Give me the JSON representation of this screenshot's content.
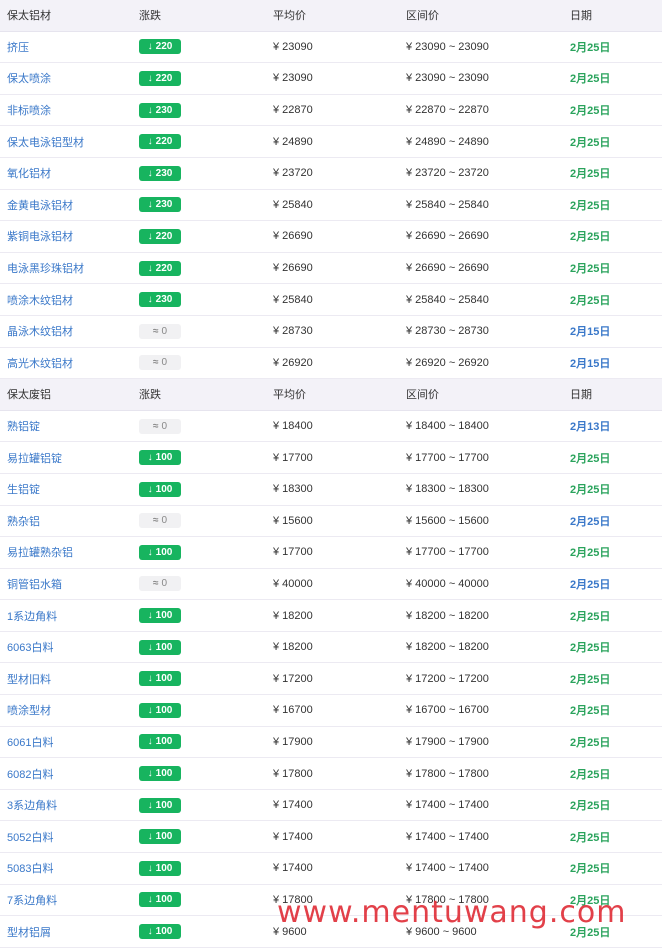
{
  "colors": {
    "down_badge": "#17b45f",
    "flat_badge": "#f1f1f3",
    "name_link": "#3a78c9",
    "date_green": "#2aa35c",
    "date_blue": "#3a78c9",
    "watermark": "#e0303a"
  },
  "icons": {
    "down": "down-arrow-icon",
    "flat": "approx-icon"
  },
  "sections": [
    {
      "header": {
        "category": "保太铝材",
        "change": "涨跌",
        "avg": "平均价",
        "range": "区间价",
        "date": "日期"
      },
      "rows": [
        {
          "name": "挤压",
          "trend": "down",
          "change": "220",
          "avg": "¥ 23090",
          "range": "¥ 23090 ~ 23090",
          "date": "2月25日",
          "date_color": "green"
        },
        {
          "name": "保太喷涂",
          "trend": "down",
          "change": "220",
          "avg": "¥ 23090",
          "range": "¥ 23090 ~ 23090",
          "date": "2月25日",
          "date_color": "green"
        },
        {
          "name": "非标喷涂",
          "trend": "down",
          "change": "230",
          "avg": "¥ 22870",
          "range": "¥ 22870 ~ 22870",
          "date": "2月25日",
          "date_color": "green"
        },
        {
          "name": "保太电泳铝型材",
          "trend": "down",
          "change": "220",
          "avg": "¥ 24890",
          "range": "¥ 24890 ~ 24890",
          "date": "2月25日",
          "date_color": "green"
        },
        {
          "name": "氧化铝材",
          "trend": "down",
          "change": "230",
          "avg": "¥ 23720",
          "range": "¥ 23720 ~ 23720",
          "date": "2月25日",
          "date_color": "green"
        },
        {
          "name": "金黄电泳铝材",
          "trend": "down",
          "change": "230",
          "avg": "¥ 25840",
          "range": "¥ 25840 ~ 25840",
          "date": "2月25日",
          "date_color": "green"
        },
        {
          "name": "紫铜电泳铝材",
          "trend": "down",
          "change": "220",
          "avg": "¥ 26690",
          "range": "¥ 26690 ~ 26690",
          "date": "2月25日",
          "date_color": "green"
        },
        {
          "name": "电泳黑珍珠铝材",
          "trend": "down",
          "change": "220",
          "avg": "¥ 26690",
          "range": "¥ 26690 ~ 26690",
          "date": "2月25日",
          "date_color": "green"
        },
        {
          "name": "喷涂木纹铝材",
          "trend": "down",
          "change": "230",
          "avg": "¥ 25840",
          "range": "¥ 25840 ~ 25840",
          "date": "2月25日",
          "date_color": "green"
        },
        {
          "name": "晶泳木纹铝材",
          "trend": "flat",
          "change": "0",
          "avg": "¥ 28730",
          "range": "¥ 28730 ~ 28730",
          "date": "2月15日",
          "date_color": "blue"
        },
        {
          "name": "高光木纹铝材",
          "trend": "flat",
          "change": "0",
          "avg": "¥ 26920",
          "range": "¥ 26920 ~ 26920",
          "date": "2月15日",
          "date_color": "blue"
        }
      ]
    },
    {
      "header": {
        "category": "保太废铝",
        "change": "涨跌",
        "avg": "平均价",
        "range": "区间价",
        "date": "日期"
      },
      "rows": [
        {
          "name": "熟铝锭",
          "trend": "flat",
          "change": "0",
          "avg": "¥ 18400",
          "range": "¥ 18400 ~ 18400",
          "date": "2月13日",
          "date_color": "blue"
        },
        {
          "name": "易拉罐铝锭",
          "trend": "down",
          "change": "100",
          "avg": "¥ 17700",
          "range": "¥ 17700 ~ 17700",
          "date": "2月25日",
          "date_color": "green"
        },
        {
          "name": "生铝锭",
          "trend": "down",
          "change": "100",
          "avg": "¥ 18300",
          "range": "¥ 18300 ~ 18300",
          "date": "2月25日",
          "date_color": "green"
        },
        {
          "name": "熟杂铝",
          "trend": "flat",
          "change": "0",
          "avg": "¥ 15600",
          "range": "¥ 15600 ~ 15600",
          "date": "2月25日",
          "date_color": "blue"
        },
        {
          "name": "易拉罐熟杂铝",
          "trend": "down",
          "change": "100",
          "avg": "¥ 17700",
          "range": "¥ 17700 ~ 17700",
          "date": "2月25日",
          "date_color": "green"
        },
        {
          "name": "铜管铝水箱",
          "trend": "flat",
          "change": "0",
          "avg": "¥ 40000",
          "range": "¥ 40000 ~ 40000",
          "date": "2月25日",
          "date_color": "blue"
        },
        {
          "name": "1系边角料",
          "trend": "down",
          "change": "100",
          "avg": "¥ 18200",
          "range": "¥ 18200 ~ 18200",
          "date": "2月25日",
          "date_color": "green"
        },
        {
          "name": "6063白料",
          "trend": "down",
          "change": "100",
          "avg": "¥ 18200",
          "range": "¥ 18200 ~ 18200",
          "date": "2月25日",
          "date_color": "green"
        },
        {
          "name": "型材旧料",
          "trend": "down",
          "change": "100",
          "avg": "¥ 17200",
          "range": "¥ 17200 ~ 17200",
          "date": "2月25日",
          "date_color": "green"
        },
        {
          "name": "喷涂型材",
          "trend": "down",
          "change": "100",
          "avg": "¥ 16700",
          "range": "¥ 16700 ~ 16700",
          "date": "2月25日",
          "date_color": "green"
        },
        {
          "name": "6061白料",
          "trend": "down",
          "change": "100",
          "avg": "¥ 17900",
          "range": "¥ 17900 ~ 17900",
          "date": "2月25日",
          "date_color": "green"
        },
        {
          "name": "6082白料",
          "trend": "down",
          "change": "100",
          "avg": "¥ 17800",
          "range": "¥ 17800 ~ 17800",
          "date": "2月25日",
          "date_color": "green"
        },
        {
          "name": "3系边角料",
          "trend": "down",
          "change": "100",
          "avg": "¥ 17400",
          "range": "¥ 17400 ~ 17400",
          "date": "2月25日",
          "date_color": "green"
        },
        {
          "name": "5052白料",
          "trend": "down",
          "change": "100",
          "avg": "¥ 17400",
          "range": "¥ 17400 ~ 17400",
          "date": "2月25日",
          "date_color": "green"
        },
        {
          "name": "5083白料",
          "trend": "down",
          "change": "100",
          "avg": "¥ 17400",
          "range": "¥ 17400 ~ 17400",
          "date": "2月25日",
          "date_color": "green"
        },
        {
          "name": "7系边角料",
          "trend": "down",
          "change": "100",
          "avg": "¥ 17800",
          "range": "¥ 17800 ~ 17800",
          "date": "2月25日",
          "date_color": "green"
        },
        {
          "name": "型材铝屑",
          "trend": "down",
          "change": "100",
          "avg": "¥ 9600",
          "range": "¥ 9600 ~ 9600",
          "date": "2月25日",
          "date_color": "green"
        }
      ]
    }
  ],
  "watermark": "www.mentuwang.com"
}
